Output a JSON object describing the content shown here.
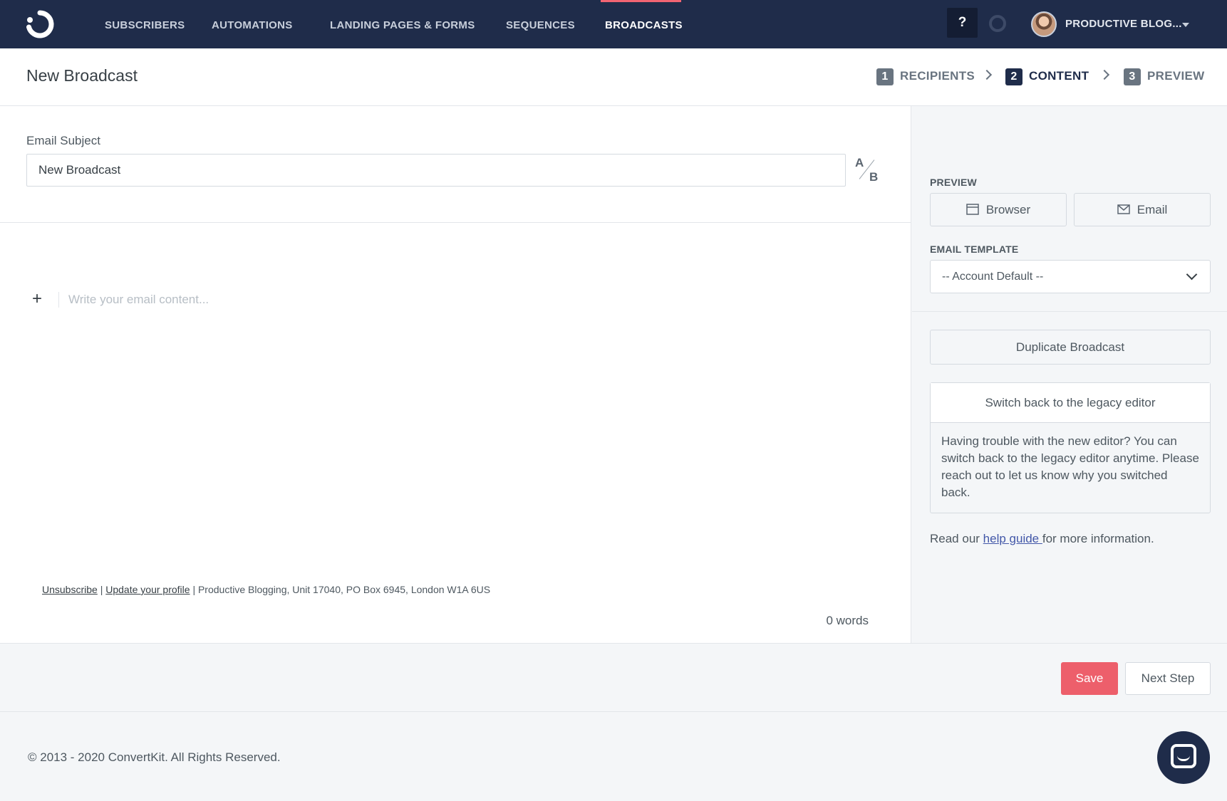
{
  "nav": {
    "items": [
      "SUBSCRIBERS",
      "AUTOMATIONS",
      "LANDING PAGES & FORMS",
      "SEQUENCES",
      "BROADCASTS"
    ],
    "active": "BROADCASTS",
    "help_label": "?",
    "account_name": "PRODUCTIVE BLOG..."
  },
  "header": {
    "title": "New Broadcast",
    "steps": [
      {
        "num": "1",
        "label": "RECIPIENTS"
      },
      {
        "num": "2",
        "label": "CONTENT"
      },
      {
        "num": "3",
        "label": "PREVIEW"
      }
    ],
    "current_step": "2"
  },
  "editor": {
    "subject_label": "Email Subject",
    "subject_value": "New Broadcast",
    "ab_a": "A",
    "ab_b": "B",
    "add_label": "+",
    "content_placeholder": "Write your email content...",
    "footer_unsubscribe": "Unsubscribe",
    "footer_separator": "|",
    "footer_update_profile": "Update your profile",
    "footer_address": "Productive Blogging, Unit 17040, PO Box 6945, London W1A 6US",
    "word_count": "0 words"
  },
  "sidebar": {
    "preview_label": "PREVIEW",
    "preview_browser": "Browser",
    "preview_email": "Email",
    "template_label": "EMAIL TEMPLATE",
    "template_value": "-- Account Default --",
    "duplicate_label": "Duplicate Broadcast",
    "legacy_button": "Switch back to the legacy editor",
    "legacy_text": "Having trouble with the new editor? You can switch back to the legacy editor anytime. Please reach out to let us know why you switched back.",
    "help_prefix": "Read our ",
    "help_link": "help guide ",
    "help_suffix": "for more information."
  },
  "actions": {
    "save": "Save",
    "next": "Next Step"
  },
  "footer": {
    "copyright": "© 2013 - 2020 ConvertKit. All Rights Reserved."
  },
  "colors": {
    "nav_bg": "#1f2c4a",
    "accent": "#ed5f6b",
    "link": "#4257a8"
  },
  "icons": {
    "logo": "convertkit-logo-icon",
    "browser": "browser-window-icon",
    "email": "envelope-icon",
    "chat": "chat-bubble-icon"
  }
}
